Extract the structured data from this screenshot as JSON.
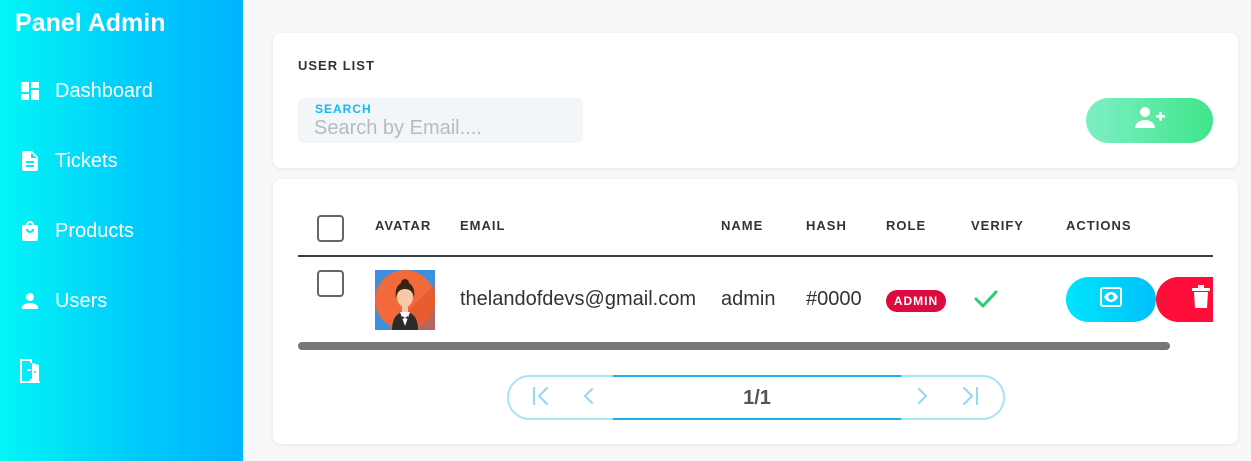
{
  "sidebar": {
    "brand": "Panel Admin",
    "items": [
      {
        "label": "Dashboard",
        "icon": "dashboard-icon"
      },
      {
        "label": "Tickets",
        "icon": "document-icon"
      },
      {
        "label": "Products",
        "icon": "shopping-bag-icon"
      },
      {
        "label": "Users",
        "icon": "user-icon"
      },
      {
        "label": "",
        "icon": "logout-door-icon"
      }
    ]
  },
  "user_list": {
    "title": "USER LIST",
    "search": {
      "label": "SEARCH",
      "placeholder": "Search by Email....",
      "value": ""
    },
    "add_button_icon": "add-user-icon"
  },
  "table": {
    "headers": {
      "avatar": "AVATAR",
      "email": "EMAIL",
      "name": "NAME",
      "hash": "HASH",
      "role": "ROLE",
      "verify": "VERIFY",
      "actions": "ACTIONS"
    },
    "rows": [
      {
        "email": "thelandofdevs@gmail.com",
        "name": "admin",
        "hash": "#0000",
        "role": "ADMIN",
        "verified": true
      }
    ]
  },
  "pagination": {
    "page_text": "1/1"
  },
  "colors": {
    "sidebar_start": "#03f5f7",
    "sidebar_end": "#00b3fd",
    "add_button": "#3fe58a",
    "view_button": "#00d4fc",
    "delete_button": "#fd0d37",
    "role_badge": "#dc0b3f",
    "verify_check": "#2ecc71"
  }
}
